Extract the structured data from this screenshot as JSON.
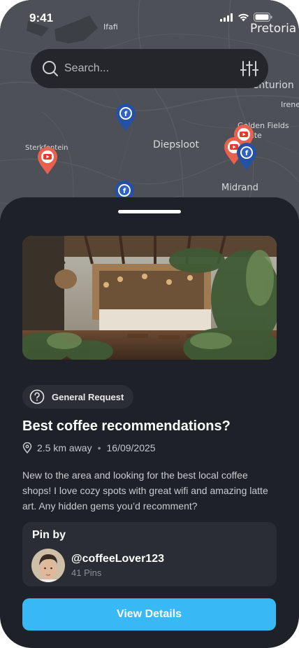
{
  "status_bar": {
    "time": "9:41"
  },
  "map": {
    "labels": {
      "ifafi": "Ifafi",
      "pretoria": "Pretoria",
      "centurion": "Centurion",
      "irene": "Irene",
      "golden_fields": "Golden Fields\nEstate",
      "diepsloot": "Diepsloot",
      "sterkfontein": "Sterkfontein",
      "midrand": "Midrand"
    },
    "pins": [
      {
        "kind": "facebook",
        "color": "#2451a3"
      },
      {
        "kind": "youtube",
        "color": "#e8614f"
      },
      {
        "kind": "youtube",
        "color": "#e8614f"
      },
      {
        "kind": "youtube",
        "color": "#e8614f"
      },
      {
        "kind": "facebook",
        "color": "#2451a3"
      },
      {
        "kind": "facebook",
        "color": "#2451a3"
      }
    ]
  },
  "search": {
    "placeholder": "Search...",
    "icon": "search-icon",
    "filter_icon": "sliders-icon"
  },
  "card": {
    "category": "General Request",
    "category_icon": "question-circle-icon",
    "title": "Best coffee recommendations?",
    "distance": "2.5 km away",
    "date": "16/09/2025",
    "description": "New to the area and looking for the best local coffee shops! I love cozy spots with great wifi and amazing latte art. Any hidden gems you’d recomment?",
    "pin_by_label": "Pin by",
    "author": {
      "username": "@coffeeLover123",
      "pins": "41 Pins"
    },
    "cta_label": "View Details"
  },
  "colors": {
    "accent": "#39b8f6",
    "sheet": "#1f2128",
    "facebook_pin": "#2451a3",
    "youtube_pin": "#e8614f"
  }
}
